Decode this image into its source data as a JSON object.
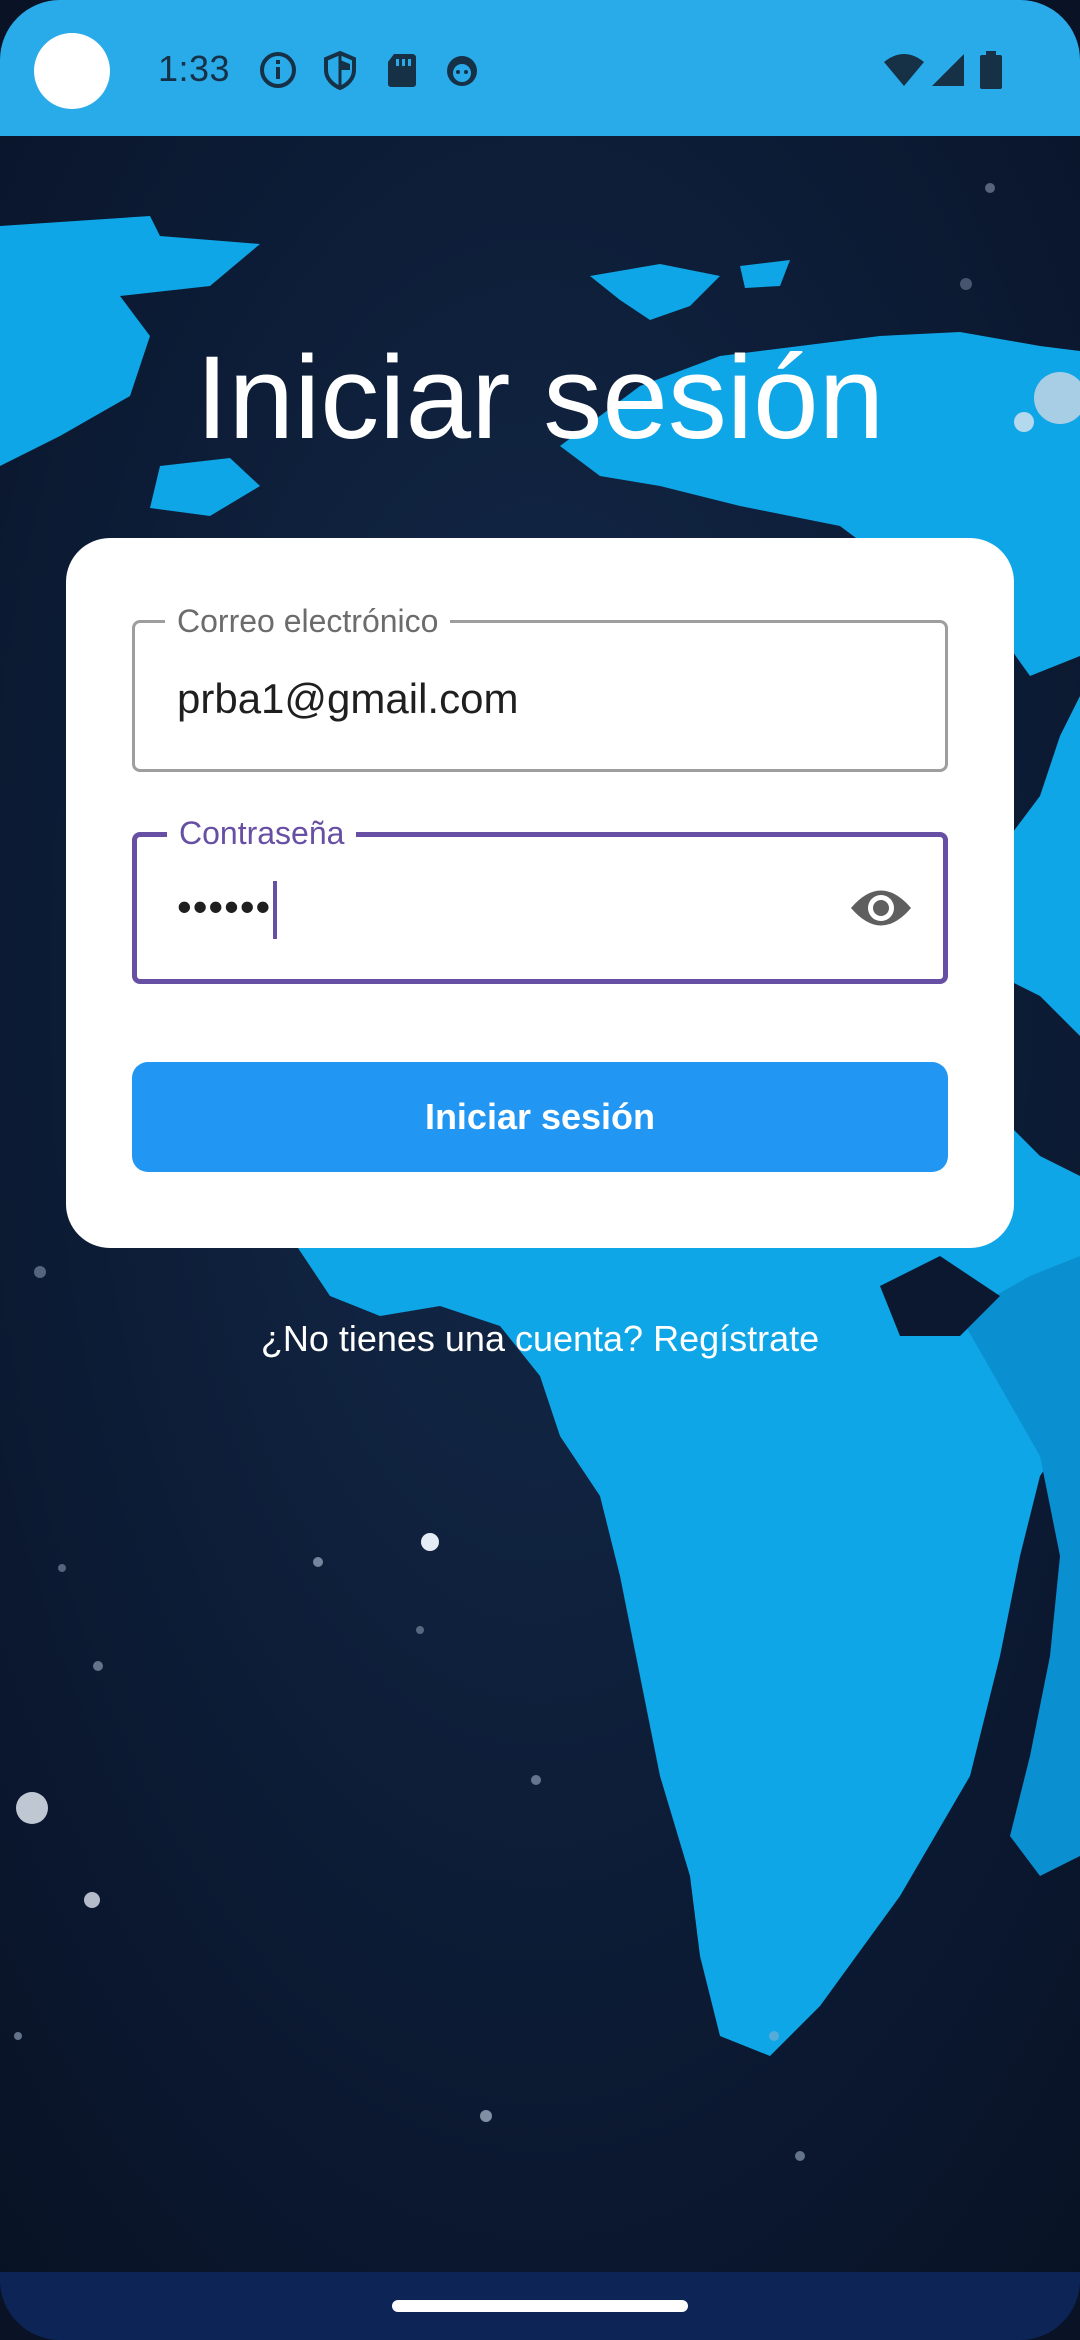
{
  "status_bar": {
    "time": "1:33",
    "icons": [
      "info-icon",
      "shield-icon",
      "sd-card-icon",
      "android-debug-icon",
      "wifi-icon",
      "cellular-signal-icon",
      "battery-icon"
    ]
  },
  "login": {
    "title": "Iniciar sesión",
    "email_label": "Correo electrónico",
    "email_value": "prba1@gmail.com",
    "password_label": "Contraseña",
    "password_value": "••••••",
    "submit_label": "Iniciar sesión",
    "signup_text": "¿No tienes una cuenta? Regístrate"
  },
  "colors": {
    "status_bar": "#29aae9",
    "primary_button": "#2196f3",
    "focus_outline": "#6750a4",
    "map_land": "#0ea6e6",
    "map_ocean": "#0b1830"
  }
}
